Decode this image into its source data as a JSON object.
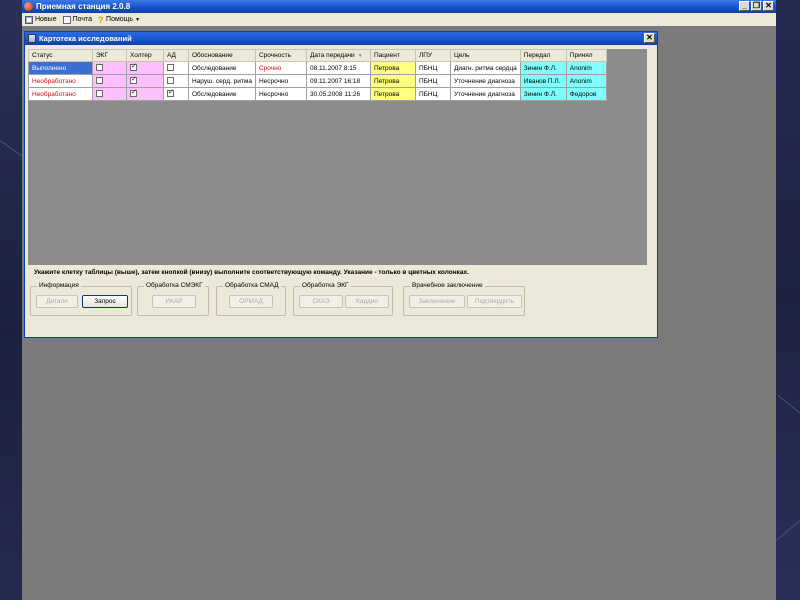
{
  "app": {
    "title": "Приемная станция 2.0.8",
    "window_controls": [
      "_",
      "❐",
      "✕"
    ]
  },
  "menu": [
    {
      "label": "Новые",
      "icon": "new-icon"
    },
    {
      "label": "Почта",
      "icon": "mail-icon"
    },
    {
      "label": "Помощь",
      "icon": "help-icon"
    }
  ],
  "child": {
    "title": "Картотека исследований",
    "close": "✕"
  },
  "table": {
    "columns": [
      "Статус",
      "ЭКГ",
      "Холтер",
      "АД",
      "Обоснование",
      "Срочность",
      "Дата передачи",
      "Пациент",
      "ЛПУ",
      "Цель",
      "Передал",
      "Принял"
    ],
    "rows": [
      {
        "status": "Выполнено",
        "ekg": false,
        "holter": true,
        "ad": false,
        "reason": "Обследование",
        "urgency": "Срочно",
        "date": "08.11.2007 8:15",
        "patient": "Петрова",
        "lpu": "ПБНЦ",
        "goal": "Диагн. ритма сердца",
        "sent": "Зинин Ф.Л.",
        "received": "Anonim"
      },
      {
        "status": "Необработано",
        "ekg": false,
        "holter": true,
        "ad": false,
        "reason": "Наруш. серд. ритма",
        "urgency": "Несрочно",
        "date": "09.11.2007 16:18",
        "patient": "Петрова",
        "lpu": "ПБНЦ",
        "goal": "Уточнение диагноза",
        "sent": "Иванов П.Л.",
        "received": "Anonim"
      },
      {
        "status": "Необработано",
        "ekg": false,
        "holter": true,
        "ad": true,
        "reason": "Обследование",
        "urgency": "Несрочно",
        "date": "30.05.2008 11:26",
        "patient": "Петрова",
        "lpu": "ПБНЦ",
        "goal": "Уточнение диагноза",
        "sent": "Зинин Ф.Л.",
        "received": "Федоров"
      }
    ]
  },
  "hint": "Укажите клетку таблицы (выше), затем кнопкой (внизу) выполните соответствующую команду. Указание - только в цветных колонках.",
  "groups": [
    {
      "legend": "Информация",
      "buttons": [
        "Детали",
        "Запрос"
      ]
    },
    {
      "legend": "Обработка СМЭКГ",
      "buttons": [
        "ИКАР"
      ]
    },
    {
      "legend": "Обработка СМАД",
      "buttons": [
        "ОРМАД"
      ]
    },
    {
      "legend": "Обработка ЭКГ",
      "buttons": [
        "СКАЭ",
        "Кардио"
      ]
    },
    {
      "legend": "Врачебное заключение",
      "buttons": [
        "Заключение",
        "Подтвердить"
      ]
    }
  ],
  "colors": {
    "selected_status": "#3d6fd0",
    "unprocessed_text": "#d01010",
    "checkbox_columns": "#ffc0ff",
    "patient_column": "#ffff80",
    "staff_columns": "#80ffff",
    "window_titlebar": "#1450c8"
  }
}
